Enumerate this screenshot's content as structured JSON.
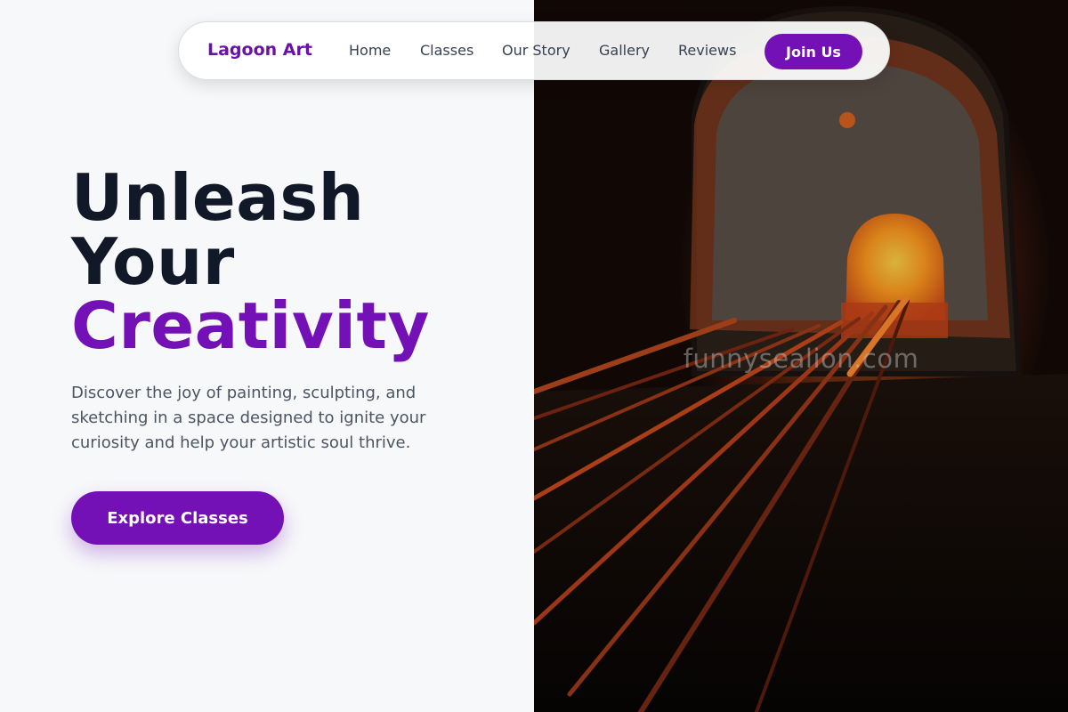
{
  "nav": {
    "brand": "Lagoon Art",
    "links": [
      "Home",
      "Classes",
      "Our Story",
      "Gallery",
      "Reviews"
    ],
    "cta": "Join Us"
  },
  "hero": {
    "headline_line1": "Unleash",
    "headline_line2": "Your",
    "headline_line3": "Creativity",
    "description": "Discover the joy of painting, sculpting, and sketching in a space designed to ignite your curiosity and help your artistic soul thrive.",
    "button": "Explore Classes"
  },
  "image": {
    "watermark": "funnysealion.com"
  },
  "colors": {
    "accent": "#7311b6",
    "headline": "#111827",
    "body_text": "#4b5563",
    "background": "#f7f8fa"
  }
}
